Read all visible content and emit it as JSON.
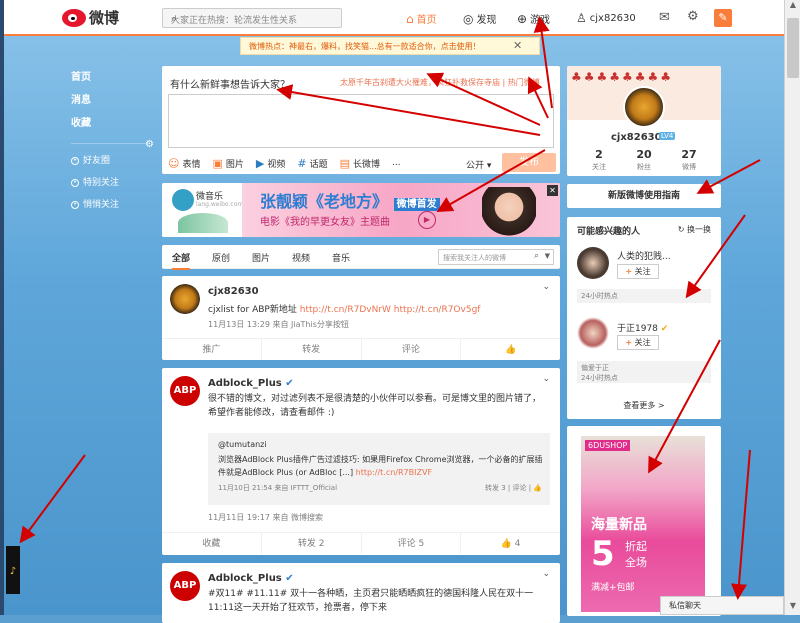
{
  "topbar": {
    "logo_text": "微博",
    "search_placeholder": "大家正在热搜：轮流发生性关系",
    "nav": {
      "home": "首页",
      "discover": "发现",
      "game": "游戏",
      "user": "cjx82630"
    }
  },
  "notice": {
    "text": "微博热点：神最右，爆料，找笑猫...总有一款适合你，点击使用！"
  },
  "sidebar": {
    "main": [
      "首页",
      "消息",
      "收藏"
    ],
    "groups": [
      "好友圈",
      "特别关注",
      "悄悄关注"
    ]
  },
  "compose": {
    "title": "有什么新鲜事想告诉大家？",
    "hot": "太原千年古刹遭大火罹难，疯狂扑救保存寺庙 | 热门微博",
    "tools": [
      "表情",
      "图片",
      "视频",
      "话题",
      "长微博",
      "..."
    ],
    "public": "公开",
    "send": "发布"
  },
  "ad": {
    "brand": "微音乐",
    "brand_sub": "lang.weibo.com",
    "title": "张靓颖《老地方》",
    "title_badge": "微博首发",
    "subtitle": "电影《我的早更女友》主题曲",
    "close": "✕"
  },
  "feed_tabs": {
    "tabs": [
      "全部",
      "原创",
      "图片",
      "视频",
      "音乐"
    ],
    "search_placeholder": "搜索我关注人的微博"
  },
  "posts": [
    {
      "name": "cjx82630",
      "text_prefix": "cjxlist for ABP新地址",
      "links": "http://t.cn/R7DvNrW http://t.cn/R7Ov5gf",
      "meta": "11月13日 13:29 来自 JiaThis分享按钮",
      "actions": [
        "推广",
        "转发",
        "评论",
        "👍"
      ]
    },
    {
      "name": "Adblock_Plus",
      "text": "很不错的博文，对过滤列表不是很清楚的小伙伴可以参看。可是博文里的图片错了，希望作者能修改，请查看邮件 :)",
      "quote_user": "@tumutanzi",
      "quote_text_prefix": "浏览器AdBlock Plus插件广告过滤技巧: 如果用Firefox Chrome浏览器，一个必备的扩展插件就是AdBlock Plus (or AdBloc [...]",
      "quote_link": "http://t.cn/R7BIZVF",
      "quote_meta": "11月10日 21:54 来自 IFTTT_Official",
      "quote_actions": "转发 3 | 评论 | 👍",
      "meta": "11月11日 19:17 来自 微博搜索",
      "actions": [
        "收藏",
        "转发 2",
        "评论 5",
        "👍 4"
      ]
    },
    {
      "name": "Adblock_Plus",
      "text": "#双11# #11.11# 双十一各种晒，主页君只能晒晒疯狂的德国科隆人民在双十一11:11这一天开始了狂欢节，抢票者，停下来"
    }
  ],
  "profile": {
    "name": "cjx82630",
    "level": "LV4",
    "stats": [
      {
        "n": "2",
        "label": "关注"
      },
      {
        "n": "20",
        "label": "粉丝"
      },
      {
        "n": "27",
        "label": "微博"
      }
    ]
  },
  "guide": "新版微博使用指南",
  "people": {
    "title": "可能感兴趣的人",
    "refresh": "换一换",
    "list": [
      {
        "name": "人类的犯贱...",
        "follow": "关注",
        "note": "24小时热点"
      },
      {
        "name": "于正1978",
        "follow": "关注",
        "note": "偏爱于正",
        "note2": "24小时热点"
      }
    ],
    "more": "查看更多 >"
  },
  "shop": {
    "brand": "6DUSHOP",
    "t1": "海量新品",
    "t2": "5",
    "t3": "折起",
    "t4": "全场",
    "t5": "满减+包邮"
  },
  "chat": "私信聊天",
  "colors": {
    "accent": "#fa7d3c",
    "link": "#eb7350",
    "blue": "#2d7dd1"
  }
}
